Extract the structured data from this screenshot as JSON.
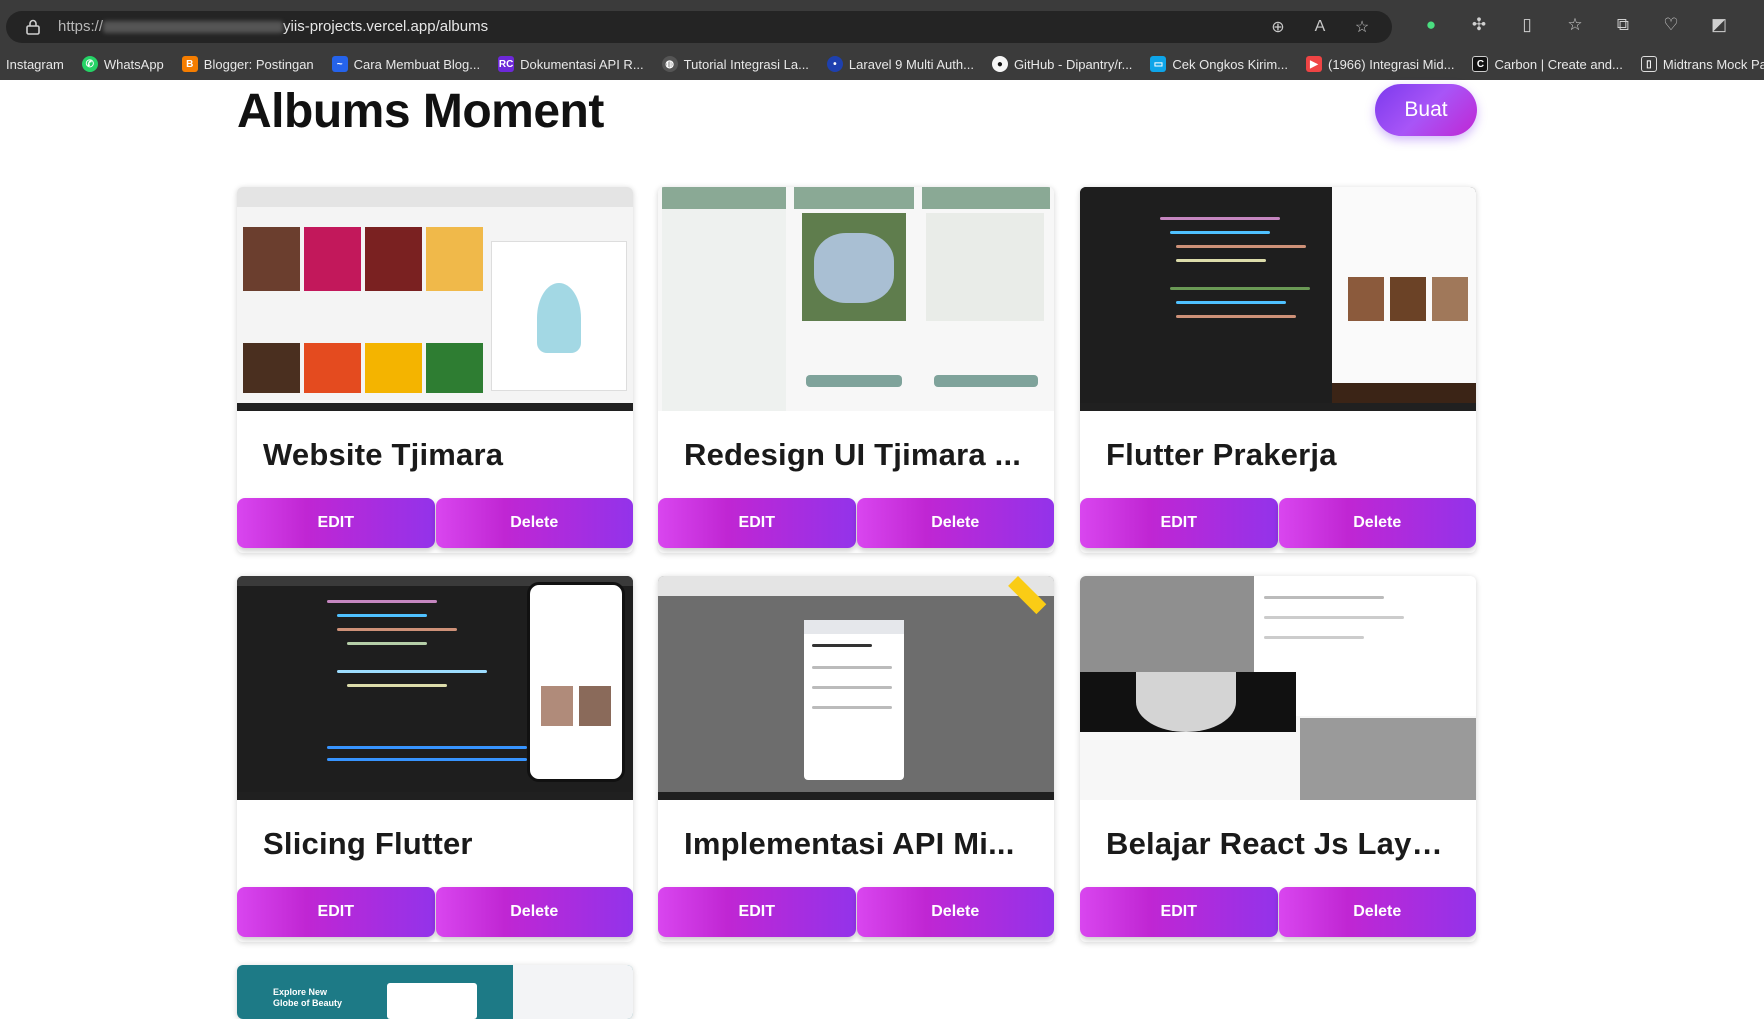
{
  "browser": {
    "url_prefix": "https://",
    "url_rest": "yiis-projects.vercel.app/albums",
    "bookmarks": [
      {
        "label": "Instagram",
        "color": "#3b3b3b",
        "icon": "instagram-icon"
      },
      {
        "label": "WhatsApp",
        "color": "#25d366",
        "icon": "whatsapp-icon"
      },
      {
        "label": "Blogger: Postingan",
        "color": "#f57d00",
        "icon": "blogger-icon"
      },
      {
        "label": "Cara Membuat Blog...",
        "color": "#2563eb",
        "icon": "blog-icon"
      },
      {
        "label": "Dokumentasi API R...",
        "color": "#6d28d9",
        "icon": "rajaongkir-icon"
      },
      {
        "label": "Tutorial Integrasi La...",
        "color": "#555555",
        "icon": "globe-icon"
      },
      {
        "label": "Laravel 9 Multi Auth...",
        "color": "#1e40af",
        "icon": "laravel-icon"
      },
      {
        "label": "GitHub - Dipantry/r...",
        "color": "#111111",
        "icon": "github-icon"
      },
      {
        "label": "Cek Ongkos Kirim...",
        "color": "#0ea5e9",
        "icon": "shipping-icon"
      },
      {
        "label": "(1966) Integrasi Mid...",
        "color": "#ef4444",
        "icon": "youtube-icon"
      },
      {
        "label": "Carbon | Create and...",
        "color": "#111111",
        "icon": "carbon-icon"
      },
      {
        "label": "Midtrans Mock Pay...",
        "color": "#9ca3af",
        "icon": "document-icon"
      }
    ]
  },
  "page": {
    "title": "Albums Moment",
    "create_button": "Buat"
  },
  "albums": [
    {
      "title": "Website Tjimara",
      "edit": "EDIT",
      "delete": "Delete"
    },
    {
      "title": "Redesign UI Tjimara ...",
      "edit": "EDIT",
      "delete": "Delete"
    },
    {
      "title": "Flutter Prakerja",
      "edit": "EDIT",
      "delete": "Delete"
    },
    {
      "title": "Slicing Flutter",
      "edit": "EDIT",
      "delete": "Delete"
    },
    {
      "title": "Implementasi API Mi...",
      "edit": "EDIT",
      "delete": "Delete"
    },
    {
      "title": "Belajar React Js Layout",
      "edit": "EDIT",
      "delete": "Delete"
    }
  ],
  "partial_card": {
    "thumb_text_1": "Explore New",
    "thumb_text_2": "Globe of Beauty"
  }
}
